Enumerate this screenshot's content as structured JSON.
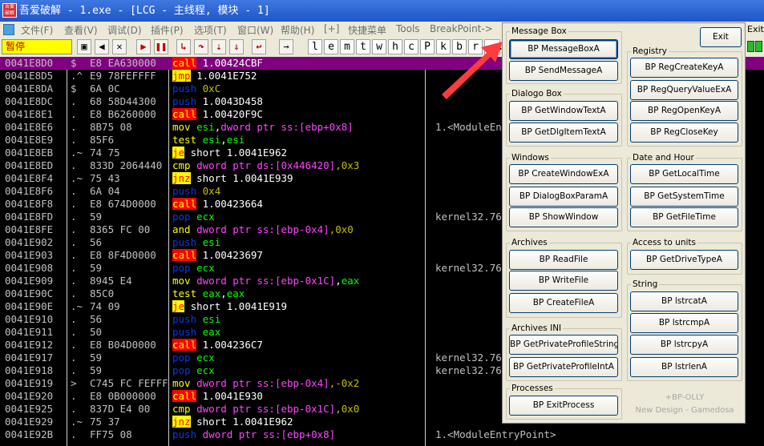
{
  "window": {
    "logo_text": "吾爱破解",
    "title": "吾爱破解 - 1.exe - [LCG - 主线程, 模块 - 1]"
  },
  "menubar": {
    "items": [
      "文件(F)",
      "查看(V)",
      "调试(D)",
      "插件(P)",
      "选项(T)",
      "窗口(W)",
      "帮助(H)",
      "[+]",
      "快捷菜单",
      "Tools",
      "BreakPoint->"
    ]
  },
  "toolbar": {
    "status": "暂停",
    "buttons": [
      "open-icon",
      "rewind-icon",
      "close-icon",
      "run-icon",
      "pause-icon",
      "step-into-icon",
      "step-over-icon",
      "trace-into-icon",
      "trace-over-icon",
      "execute-till-return-icon",
      "goto-icon"
    ],
    "letters": [
      "l",
      "e",
      "m",
      "t",
      "w",
      "h",
      "c",
      "P",
      "k",
      "b",
      "r",
      "..."
    ]
  },
  "background_exit_text": "Exit",
  "code": {
    "rows": [
      {
        "addr": "0041E8D0",
        "mark": "$",
        "hex": "E8 EA630000",
        "op": "call",
        "cls": "k-call",
        "args": [
          [
            "1.00424CBF",
            "op-txt"
          ]
        ],
        "comment": "",
        "selected": true
      },
      {
        "addr": "0041E8D5",
        "mark": ".^",
        "hex": "E9 78FEFFFF",
        "op": "jmp",
        "cls": "k-jmp",
        "args": [
          [
            "1.0041E752",
            "op-txt"
          ]
        ],
        "comment": ""
      },
      {
        "addr": "0041E8DA",
        "mark": "$",
        "hex": "6A 0C",
        "op": "push",
        "cls": "k-push",
        "args": [
          [
            "0xC",
            "op-imm"
          ]
        ],
        "comment": ""
      },
      {
        "addr": "0041E8DC",
        "mark": ".",
        "hex": "68 58D44300",
        "op": "push",
        "cls": "k-push",
        "args": [
          [
            "1.0043D458",
            "op-txt"
          ]
        ],
        "comment": ""
      },
      {
        "addr": "0041E8E1",
        "mark": ".",
        "hex": "E8 B6260000",
        "op": "call",
        "cls": "k-call",
        "args": [
          [
            "1.00420F9C",
            "op-txt"
          ]
        ],
        "comment": ""
      },
      {
        "addr": "0041E8E6",
        "mark": ".",
        "hex": "8B75 08",
        "op": "mov",
        "cls": "k-mov",
        "args": [
          [
            "esi",
            "op-reg"
          ],
          [
            ",",
            "op-txt"
          ],
          [
            "dword ptr ss:[ebp+0x8]",
            "op-mem"
          ]
        ],
        "comment": "1.<ModuleEn"
      },
      {
        "addr": "0041E8E9",
        "mark": ".",
        "hex": "85F6",
        "op": "test",
        "cls": "k-test",
        "args": [
          [
            "esi",
            "op-reg"
          ],
          [
            ",",
            "op-txt"
          ],
          [
            "esi",
            "op-reg"
          ]
        ],
        "comment": ""
      },
      {
        "addr": "0041E8EB",
        "mark": ".~",
        "hex": "74 75",
        "op": "je",
        "cls": "k-jcc",
        "args": [
          [
            "short 1.0041E962",
            "op-txt"
          ]
        ],
        "comment": ""
      },
      {
        "addr": "0041E8ED",
        "mark": ".",
        "hex": "833D 2064440",
        "op": "cmp",
        "cls": "k-cmp",
        "args": [
          [
            "dword ptr ds:[0x446420]",
            "op-mem"
          ],
          [
            ",0x3",
            "op-imm"
          ]
        ],
        "comment": ""
      },
      {
        "addr": "0041E8F4",
        "mark": ".~",
        "hex": "75 43",
        "op": "jnz",
        "cls": "k-jcc",
        "args": [
          [
            "short 1.0041E939",
            "op-txt"
          ]
        ],
        "comment": ""
      },
      {
        "addr": "0041E8F6",
        "mark": ".",
        "hex": "6A 04",
        "op": "push",
        "cls": "k-push",
        "args": [
          [
            "0x4",
            "op-imm"
          ]
        ],
        "comment": ""
      },
      {
        "addr": "0041E8F8",
        "mark": ".",
        "hex": "E8 674D0000",
        "op": "call",
        "cls": "k-call",
        "args": [
          [
            "1.00423664",
            "op-txt"
          ]
        ],
        "comment": ""
      },
      {
        "addr": "0041E8FD",
        "mark": ".",
        "hex": "59",
        "op": "pop",
        "cls": "k-pop",
        "args": [
          [
            "ecx",
            "op-reg"
          ]
        ],
        "comment": "kernel32.76"
      },
      {
        "addr": "0041E8FE",
        "mark": ".",
        "hex": "8365 FC 00",
        "op": "and",
        "cls": "k-and",
        "args": [
          [
            "dword ptr ss:[ebp-0x4]",
            "op-mem"
          ],
          [
            ",0x0",
            "op-imm"
          ]
        ],
        "comment": ""
      },
      {
        "addr": "0041E902",
        "mark": ".",
        "hex": "56",
        "op": "push",
        "cls": "k-push",
        "args": [
          [
            "esi",
            "op-reg"
          ]
        ],
        "comment": ""
      },
      {
        "addr": "0041E903",
        "mark": ".",
        "hex": "E8 8F4D0000",
        "op": "call",
        "cls": "k-call",
        "args": [
          [
            "1.00423697",
            "op-txt"
          ]
        ],
        "comment": ""
      },
      {
        "addr": "0041E908",
        "mark": ".",
        "hex": "59",
        "op": "pop",
        "cls": "k-pop",
        "args": [
          [
            "ecx",
            "op-reg"
          ]
        ],
        "comment": "kernel32.76"
      },
      {
        "addr": "0041E909",
        "mark": ".",
        "hex": "8945 E4",
        "op": "mov",
        "cls": "k-mov",
        "args": [
          [
            "dword ptr ss:[ebp-0x1C]",
            "op-mem"
          ],
          [
            ",",
            "op-txt"
          ],
          [
            "eax",
            "op-reg"
          ]
        ],
        "comment": ""
      },
      {
        "addr": "0041E90C",
        "mark": ".",
        "hex": "85C0",
        "op": "test",
        "cls": "k-test",
        "args": [
          [
            "eax",
            "op-reg"
          ],
          [
            ",",
            "op-txt"
          ],
          [
            "eax",
            "op-reg"
          ]
        ],
        "comment": ""
      },
      {
        "addr": "0041E90E",
        "mark": ".~",
        "hex": "74 09",
        "op": "je",
        "cls": "k-jcc",
        "args": [
          [
            "short 1.0041E919",
            "op-txt"
          ]
        ],
        "comment": ""
      },
      {
        "addr": "0041E910",
        "mark": ".",
        "hex": "56",
        "op": "push",
        "cls": "k-push",
        "args": [
          [
            "esi",
            "op-reg"
          ]
        ],
        "comment": ""
      },
      {
        "addr": "0041E911",
        "mark": ".",
        "hex": "50",
        "op": "push",
        "cls": "k-push",
        "args": [
          [
            "eax",
            "op-reg"
          ]
        ],
        "comment": ""
      },
      {
        "addr": "0041E912",
        "mark": ".",
        "hex": "E8 B04D0000",
        "op": "call",
        "cls": "k-call",
        "args": [
          [
            "1.004236C7",
            "op-txt"
          ]
        ],
        "comment": ""
      },
      {
        "addr": "0041E917",
        "mark": ".",
        "hex": "59",
        "op": "pop",
        "cls": "k-pop",
        "args": [
          [
            "ecx",
            "op-reg"
          ]
        ],
        "comment": "kernel32.76"
      },
      {
        "addr": "0041E918",
        "mark": ".",
        "hex": "59",
        "op": "pop",
        "cls": "k-pop",
        "args": [
          [
            "ecx",
            "op-reg"
          ]
        ],
        "comment": "kernel32.76"
      },
      {
        "addr": "0041E919",
        "mark": ">",
        "hex": "C745 FC FEFFF",
        "op": "mov",
        "cls": "k-mov",
        "args": [
          [
            "dword ptr ss:[ebp-0x4]",
            "op-mem"
          ],
          [
            ",-0x2",
            "op-imm"
          ]
        ],
        "comment": ""
      },
      {
        "addr": "0041E920",
        "mark": ".",
        "hex": "E8 0B000000",
        "op": "call",
        "cls": "k-call",
        "args": [
          [
            "1.0041E930",
            "op-txt"
          ]
        ],
        "comment": ""
      },
      {
        "addr": "0041E925",
        "mark": ".",
        "hex": "837D E4 00",
        "op": "cmp",
        "cls": "k-cmp",
        "args": [
          [
            "dword ptr ss:[ebp-0x1C]",
            "op-mem"
          ],
          [
            ",0x0",
            "op-imm"
          ]
        ],
        "comment": ""
      },
      {
        "addr": "0041E929",
        "mark": ".~",
        "hex": "75 37",
        "op": "jnz",
        "cls": "k-jcc",
        "args": [
          [
            "short 1.0041E962",
            "op-txt"
          ]
        ],
        "comment": ""
      },
      {
        "addr": "0041E92B",
        "mark": ".",
        "hex": "FF75 08",
        "op": "push",
        "cls": "k-push",
        "args": [
          [
            "dword ptr ss:[ebp+0x8]",
            "op-mem"
          ]
        ],
        "comment": "1.<ModuleEntryPoint>"
      }
    ]
  },
  "panel": {
    "exit_label": "Exit",
    "groups": {
      "message_box": {
        "title": "Message Box",
        "buttons": [
          "BP MessageBoxA",
          "BP SendMessageA"
        ]
      },
      "dialog_box": {
        "title": "Dialogo Box",
        "buttons": [
          "BP GetWindowTextA",
          "BP GetDlgItemTextA"
        ]
      },
      "windows": {
        "title": "Windows",
        "buttons": [
          "BP CreateWindowExA",
          "BP DialogBoxParamA",
          "BP ShowWindow"
        ]
      },
      "archives": {
        "title": "Archives",
        "buttons": [
          "BP ReadFile",
          "BP WriteFile",
          "BP CreateFileA"
        ]
      },
      "archives_ini": {
        "title": "Archives INI",
        "buttons": [
          "BP GetPrivateProfileStringA",
          "BP GetPrivateProfileIntA"
        ]
      },
      "processes": {
        "title": "Processes",
        "buttons": [
          "BP ExitProcess"
        ]
      },
      "registry": {
        "title": "Registry",
        "buttons": [
          "BP RegCreateKeyA",
          "BP RegQueryValueExA",
          "BP RegOpenKeyA",
          "BP RegCloseKey"
        ]
      },
      "date_hour": {
        "title": "Date and Hour",
        "buttons": [
          "BP GetLocalTime",
          "BP GetSystemTime",
          "BP GetFileTime"
        ]
      },
      "access_units": {
        "title": "Access to units",
        "buttons": [
          "BP GetDriveTypeA"
        ]
      },
      "string": {
        "title": "String",
        "buttons": [
          "BP lstrcatA",
          "BP lstrcmpA",
          "BP lstrcpyA",
          "BP lstrlenA"
        ]
      }
    },
    "credit_line1": "+BP-OLLY",
    "credit_line2": "New Design - Gamedosa"
  }
}
